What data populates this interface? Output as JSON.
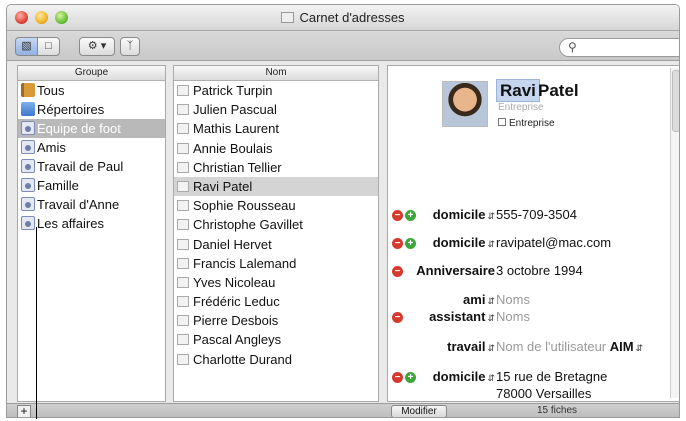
{
  "window": {
    "title": "Carnet d'adresses"
  },
  "toolbar": {
    "view_columns_icon": "columns-view-icon",
    "view_card_icon": "card-view-icon",
    "action_icon": "gear-icon",
    "action_menu_arrow": "▾",
    "bluetooth_icon": "bluetooth-icon",
    "search_icon": "search-icon",
    "search_value": ""
  },
  "groups": {
    "header": "Groupe",
    "items": [
      {
        "label": "Tous",
        "icon": "book-icon"
      },
      {
        "label": "Répertoires",
        "icon": "directory-icon"
      },
      {
        "label": "Equipe de foot",
        "icon": "group-icon",
        "selected": true
      },
      {
        "label": "Amis",
        "icon": "group-icon"
      },
      {
        "label": "Travail de Paul",
        "icon": "group-icon"
      },
      {
        "label": "Famille",
        "icon": "group-icon"
      },
      {
        "label": "Travail d'Anne",
        "icon": "group-icon"
      },
      {
        "label": "Les affaires",
        "icon": "group-icon"
      }
    ]
  },
  "names": {
    "header": "Nom",
    "items": [
      "Patrick Turpin",
      "Julien Pascual",
      "Mathis Laurent",
      "Annie Boulais",
      "Christian Tellier",
      "Ravi Patel",
      "Sophie Rousseau",
      "Christophe Gavillet",
      "Daniel Hervet",
      "Francis Lalemand",
      "Yves Nicoleau",
      "Frédéric Leduc",
      "Pierre Desbois",
      "Pascal Angleys",
      "Charlotte Durand"
    ],
    "selected": "Ravi Patel"
  },
  "card": {
    "first_name": "Ravi",
    "last_name": "Patel",
    "company_placeholder": "Entreprise",
    "company_checkbox_label": "Entreprise",
    "fields": {
      "phone_label": "domicile",
      "phone_value": "555-709-3504",
      "email_label": "domicile",
      "email_value": "ravipatel@mac.com",
      "birthday_label": "Anniversaire",
      "birthday_value": "3 octobre 1994",
      "friend_label": "ami",
      "friend_value": "Noms",
      "assistant_label": "assistant",
      "assistant_value": "Noms",
      "im_label": "travail",
      "im_value": "Nom de l'utilisateur",
      "im_service": "AIM",
      "address_label": "domicile",
      "address_line1": "15 rue de Bretagne",
      "address_line2": "78000 Versailles"
    }
  },
  "bottom": {
    "add_label": "+",
    "edit_label": "Modifier",
    "count_label": "15 fiches"
  }
}
